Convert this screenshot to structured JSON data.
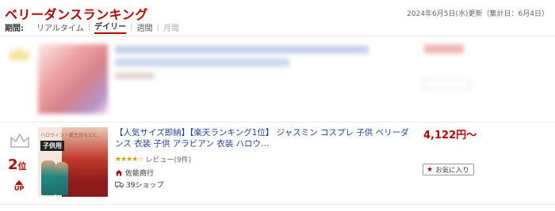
{
  "header": {
    "title": "ベリーダンスランキング",
    "updated": "2024年6月5日(水)更新（集計日：6月4日）"
  },
  "period": {
    "label": "期間:",
    "items": [
      {
        "label": "リアルタイム",
        "state": "normal"
      },
      {
        "label": "デイリー",
        "state": "active"
      },
      {
        "label": "週間",
        "state": "normal"
      },
      {
        "label": "月間",
        "state": "disabled"
      }
    ],
    "separator": "|"
  },
  "rank2": {
    "rank_number": "2",
    "rank_suffix": "位",
    "trend": "UP",
    "image": {
      "badge": "子供用",
      "caption": "ハロウィン・誕生日などに"
    },
    "title": "【人気サイズ即納】【楽天ランキング1位】 ジャスミン コスプレ 子供 ベリーダンス 衣装 子供 アラビアン 衣装 ハロウ…",
    "stars": "★★★★☆",
    "review": "レビュー(9件)",
    "shop": "佐能商行",
    "shop_count": "39ショップ",
    "price": "4,122円～",
    "favorite_label": "お気に入り"
  },
  "colors": {
    "accent": "#bf0000",
    "link": "#1d3f9b",
    "star": "#d8a400"
  }
}
